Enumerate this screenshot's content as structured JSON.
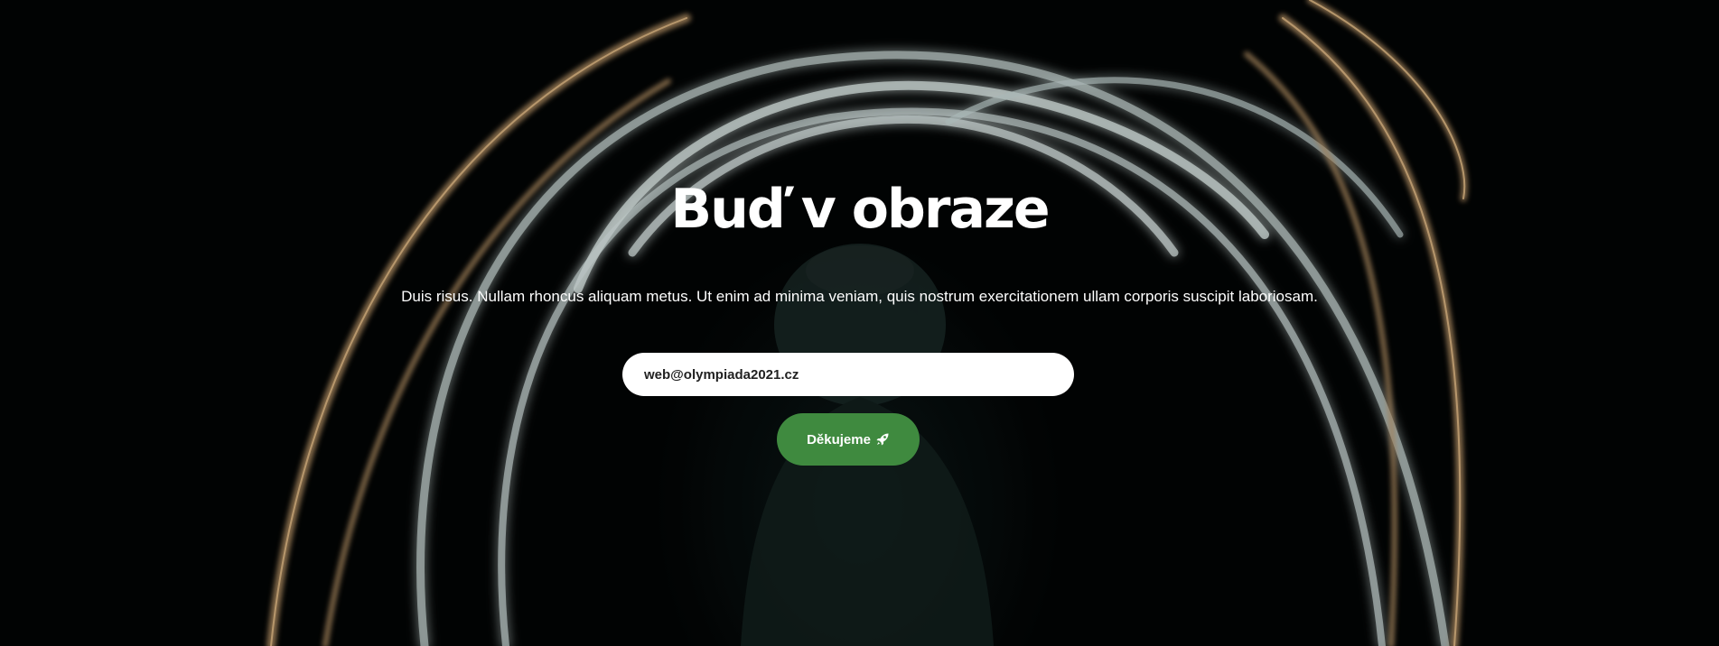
{
  "hero": {
    "title": "Buď v obraze",
    "subtitle": "Duis risus. Nullam rhoncus aliquam metus. Ut enim ad minima veniam, quis nostrum exercitationem ullam corporis suscipit laboriosam.",
    "email_value": "web@olympiada2021.cz",
    "button_label": "Děkujeme",
    "button_icon": "rocket-icon",
    "accent_color": "#3f8a3f",
    "background_image": "sparkler-light-circle-hooded-person"
  }
}
